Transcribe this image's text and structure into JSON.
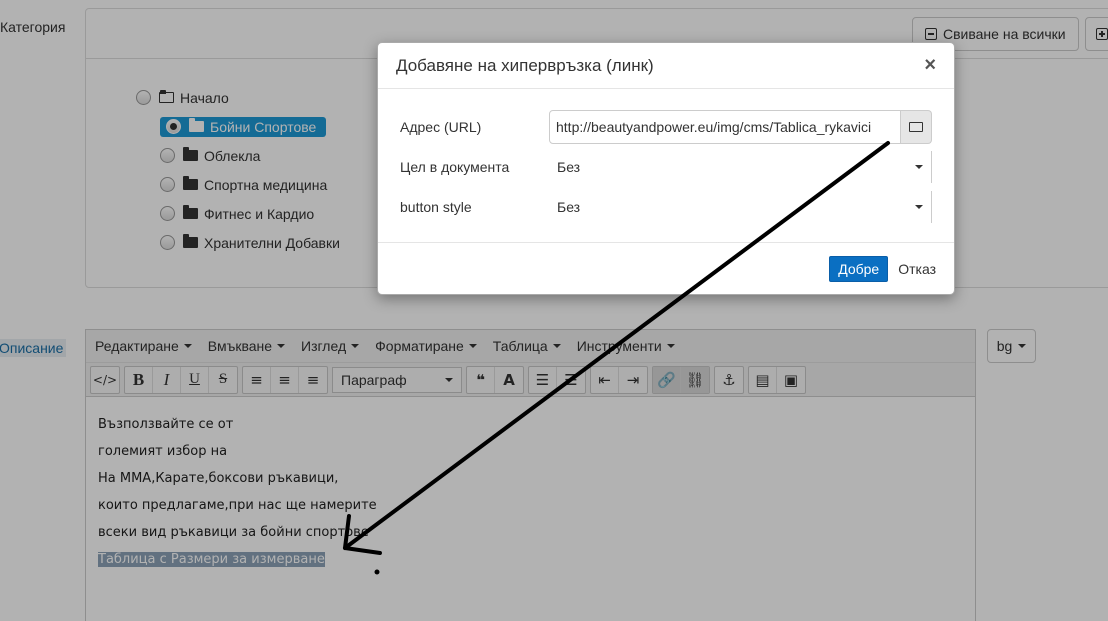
{
  "category": {
    "label": "Категория",
    "collapse_all": "Свиване на всички",
    "tree": [
      {
        "label": "Начало",
        "level": 0,
        "selected": false
      },
      {
        "label": "Бойни Спортове",
        "level": 1,
        "selected": true
      },
      {
        "label": "Облекла",
        "level": 1,
        "selected": false
      },
      {
        "label": "Спортна медицина",
        "level": 1,
        "selected": false
      },
      {
        "label": "Фитнес и Кардио",
        "level": 1,
        "selected": false
      },
      {
        "label": "Хранителни Добавки",
        "level": 1,
        "selected": false
      }
    ]
  },
  "description": {
    "label": "Описание",
    "lang": "bg",
    "menu": [
      "Редактиране",
      "Вмъкване",
      "Изглед",
      "Форматиране",
      "Таблица",
      "Инструменти"
    ],
    "format_select": "Параграф",
    "content_lines": [
      "Възползвайте се от",
      "големият избор на",
      "На ММА,Карате,боксови ръкавици,",
      "които предлагаме,при нас ще намерите",
      "всеки вид ръкавици за бойни спортове"
    ],
    "selected_line": "Таблица с Размери за измерване"
  },
  "modal": {
    "title": "Добавяне на хипервръзка (линк)",
    "close": "×",
    "url_label": "Адрес (URL)",
    "url_value": "http://beautyandpower.eu/img/cms/Tablica_rykavici",
    "target_label": "Цел в документа",
    "target_value": "Без",
    "style_label": "button style",
    "style_value": "Без",
    "ok": "Добре",
    "cancel": "Отказ"
  }
}
